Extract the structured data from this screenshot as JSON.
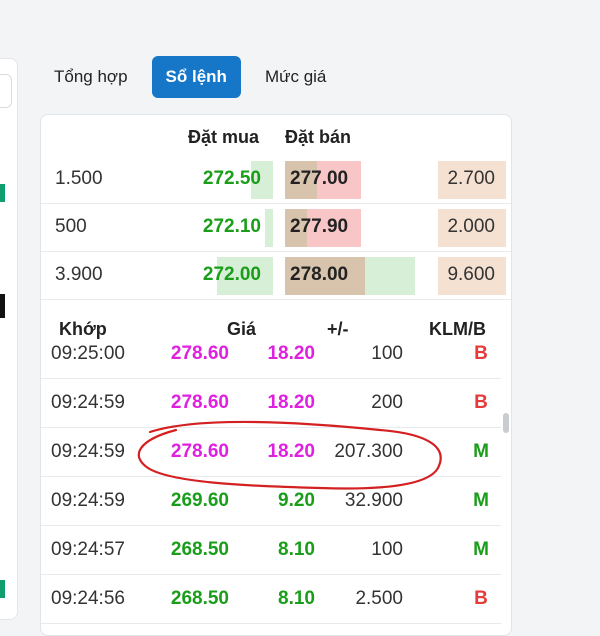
{
  "tabs": [
    {
      "label": "Tổng hợp",
      "active": false
    },
    {
      "label": "Sổ lệnh",
      "active": true
    },
    {
      "label": "Mức giá",
      "active": false
    }
  ],
  "orderbook": {
    "buy_header": "Đặt mua",
    "sell_header": "Đặt bán",
    "rows": [
      {
        "buy_qty": "1.500",
        "buy_price": "272.50",
        "sell_price": "277.00",
        "sell_qty": "2.700"
      },
      {
        "buy_qty": "500",
        "buy_price": "272.10",
        "sell_price": "277.90",
        "sell_qty": "2.000"
      },
      {
        "buy_qty": "3.900",
        "buy_price": "272.00",
        "sell_price": "278.00",
        "sell_qty": "9.600"
      }
    ]
  },
  "trades": {
    "headers": {
      "time": "Khớp",
      "price": "Giá",
      "change": "+/-",
      "volume": "KLM/B"
    },
    "rows": [
      {
        "time": "09:25:00",
        "price": "278.60",
        "change": "18.20",
        "volume": "100",
        "side": "B"
      },
      {
        "time": "09:24:59",
        "price": "278.60",
        "change": "18.20",
        "volume": "200",
        "side": "B"
      },
      {
        "time": "09:24:59",
        "price": "278.60",
        "change": "18.20",
        "volume": "207.300",
        "side": "M"
      },
      {
        "time": "09:24:59",
        "price": "269.60",
        "change": "9.20",
        "volume": "32.900",
        "side": "M"
      },
      {
        "time": "09:24:57",
        "price": "268.50",
        "change": "8.10",
        "volume": "100",
        "side": "M"
      },
      {
        "time": "09:24:56",
        "price": "268.50",
        "change": "8.10",
        "volume": "2.500",
        "side": "B"
      }
    ]
  },
  "colors": {
    "accent": "#1677c8",
    "up": "#1a9e1a",
    "ceiling": "#e020e0",
    "sell_side": "#e53b3b",
    "annotation": "#d42020"
  }
}
